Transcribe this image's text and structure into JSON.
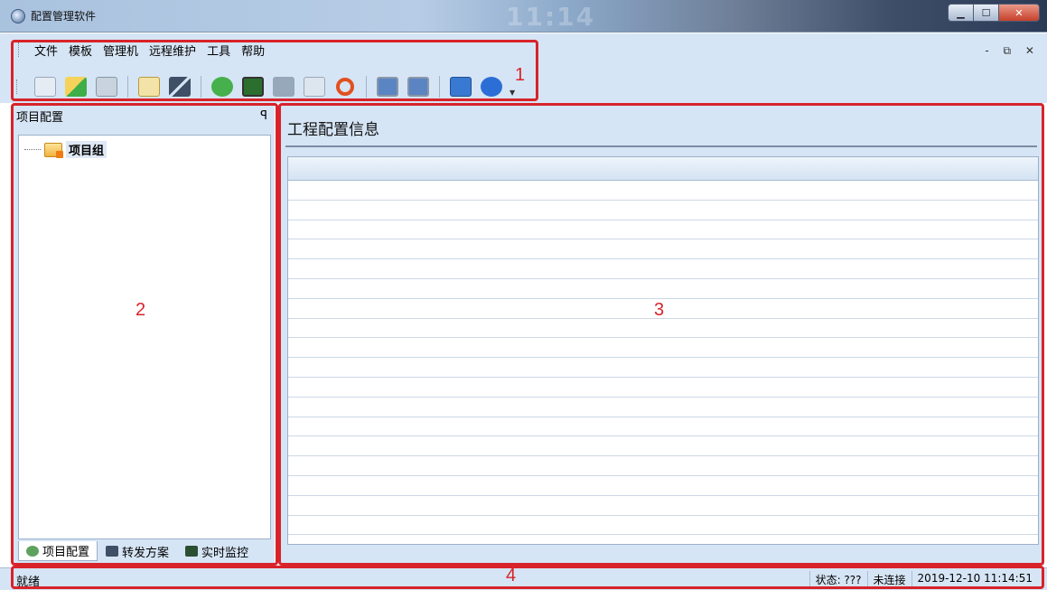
{
  "window": {
    "title": "配置管理软件",
    "clock_ghost": "11:14"
  },
  "menu": {
    "items": [
      "文件",
      "模板",
      "管理机",
      "远程维护",
      "工具",
      "帮助"
    ]
  },
  "toolbar": {
    "icons": [
      {
        "name": "new-file-icon",
        "color": "#d9e2ee"
      },
      {
        "name": "open-file-icon",
        "color": "#3fae49"
      },
      {
        "name": "save-icon",
        "color": "#c9d3de"
      },
      {
        "name": "book-icon",
        "color": "#e7c35a"
      },
      {
        "name": "link-icon",
        "color": "#3f4f66"
      },
      {
        "name": "refresh-arrow-icon",
        "color": "#45b04c"
      },
      {
        "name": "monitor-check-icon",
        "color": "#2b6e2e"
      },
      {
        "name": "monitor-grey-icon",
        "color": "#98a8bb"
      },
      {
        "name": "settings-toggle-icon",
        "color": "#b7c4d3"
      },
      {
        "name": "reload-icon",
        "color": "#e2501f"
      },
      {
        "name": "ssh-icon",
        "color": "#5a85c2"
      },
      {
        "name": "ftp-icon",
        "color": "#5a85c2"
      },
      {
        "name": "help-icon",
        "color": "#3a79d1"
      },
      {
        "name": "info-icon",
        "color": "#2b6fd6"
      }
    ]
  },
  "annotations": {
    "n1": "1",
    "n2": "2",
    "n3": "3",
    "n4": "4",
    "color": "#d8232a"
  },
  "left_panel": {
    "header": "项目配置",
    "pin_glyph": "ꟼ",
    "tree_root": "项目组",
    "tabs": [
      "项目配置",
      "转发方案",
      "实时监控"
    ]
  },
  "right_panel": {
    "title": "工程配置信息",
    "row_count": 18
  },
  "statusbar": {
    "ready": "就绪",
    "state": "状态: ???",
    "connection": "未连接",
    "datetime": "2019-12-10 11:14:51"
  }
}
